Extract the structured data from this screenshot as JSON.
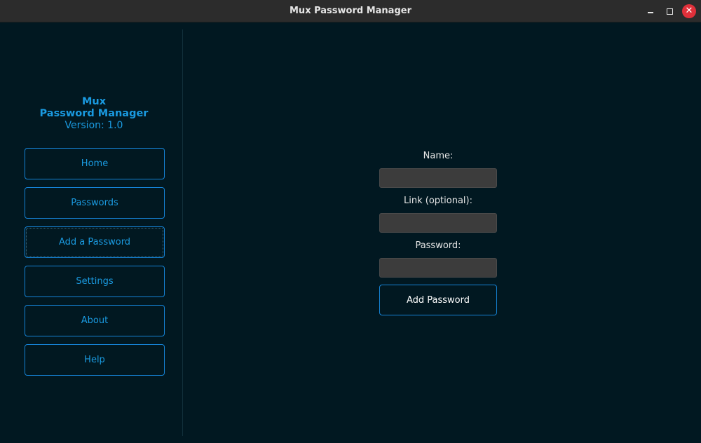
{
  "window": {
    "title": "Mux Password Manager",
    "minimize_symbol": "",
    "close_symbol": "✕"
  },
  "sidebar": {
    "brand_line1": "Mux",
    "brand_line2": "Password Manager",
    "version": "Version: 1.0",
    "items": [
      {
        "label": "Home"
      },
      {
        "label": "Passwords"
      },
      {
        "label": "Add a Password"
      },
      {
        "label": "Settings"
      },
      {
        "label": "About"
      },
      {
        "label": "Help"
      }
    ],
    "active_item": "Add a Password"
  },
  "form": {
    "name_label": "Name:",
    "name_value": "",
    "link_label": "Link (optional):",
    "link_value": "",
    "password_label": "Password:",
    "password_value": "",
    "submit_label": "Add Password"
  },
  "colors": {
    "background": "#011821",
    "accent": "#1a9ae0",
    "titlebar": "#2c2c2c",
    "close_button": "#e0303a"
  }
}
